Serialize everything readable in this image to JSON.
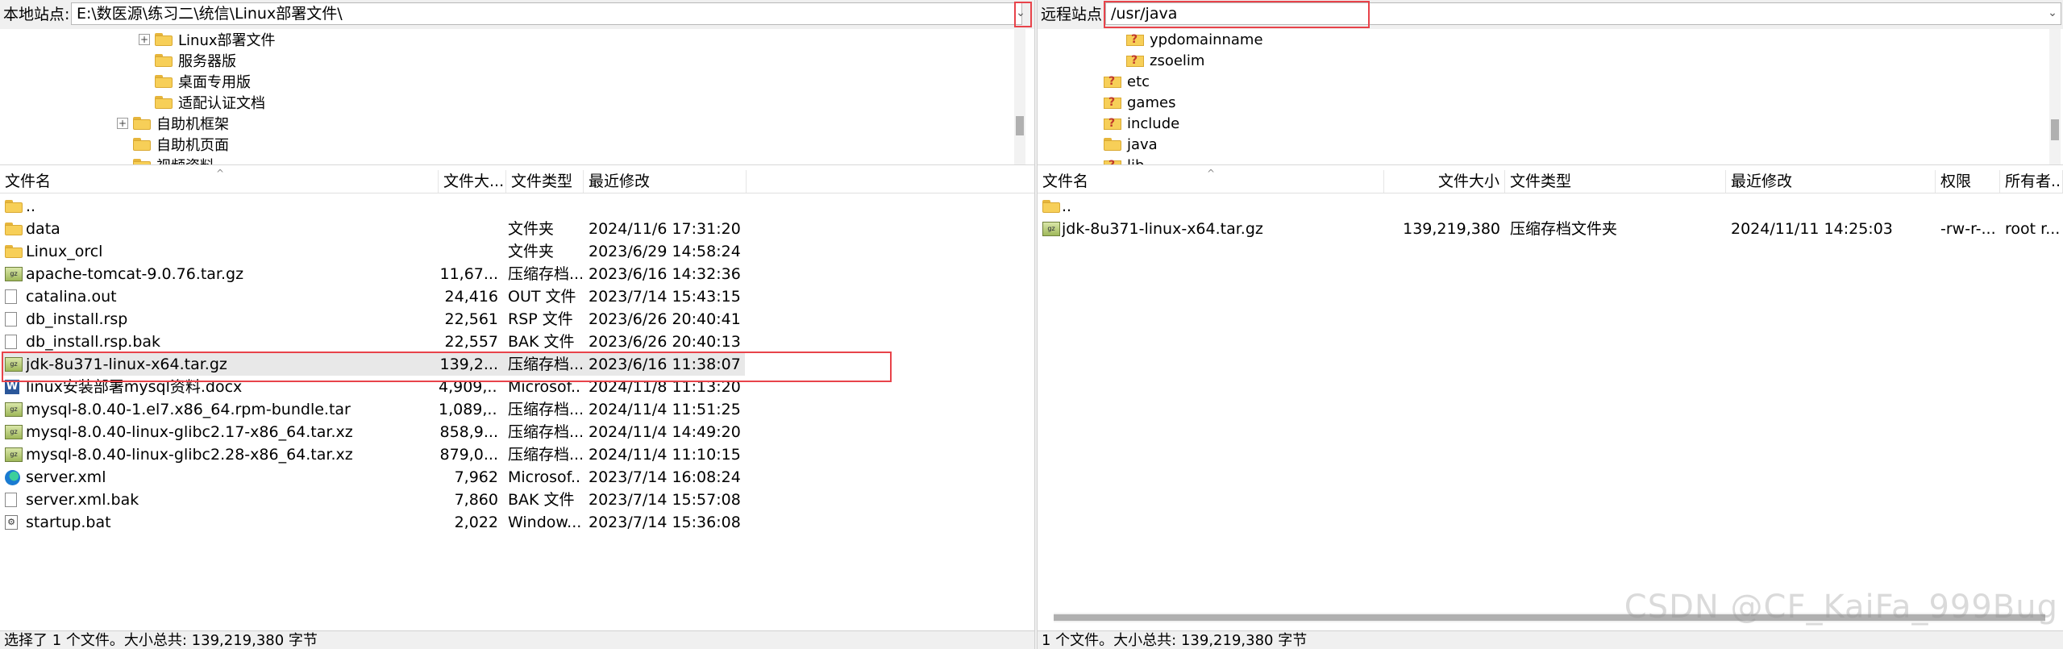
{
  "local": {
    "site_label": "本地站点:",
    "path": "E:\\数医源\\练习二\\统信\\Linux部署文件\\",
    "tree": [
      {
        "label": "Linux部署文件",
        "expander": "+"
      },
      {
        "label": "服务器版"
      },
      {
        "label": "桌面专用版"
      },
      {
        "label": "适配认证文档"
      },
      {
        "label": "自助机框架",
        "expander": "+"
      },
      {
        "label": "自助机页面"
      },
      {
        "label": "视频资料"
      }
    ],
    "columns": {
      "name": "文件名",
      "size": "文件大...",
      "type": "文件类型",
      "modified": "最近修改"
    },
    "rows": [
      {
        "name": "..",
        "size": "",
        "type": "",
        "modified": "",
        "icon": "folder-icon"
      },
      {
        "name": "data",
        "size": "",
        "type": "文件夹",
        "modified": "2024/11/6 17:31:20",
        "icon": "folder-icon"
      },
      {
        "name": "Linux_orcl",
        "size": "",
        "type": "文件夹",
        "modified": "2023/6/29 14:58:24",
        "icon": "folder-icon"
      },
      {
        "name": "apache-tomcat-9.0.76.tar.gz",
        "size": "11,67...",
        "type": "压缩存档...",
        "modified": "2023/6/16 14:32:36",
        "icon": "archive-icon"
      },
      {
        "name": "catalina.out",
        "size": "24,416",
        "type": "OUT 文件",
        "modified": "2023/7/14 15:43:15",
        "icon": "document-icon"
      },
      {
        "name": "db_install.rsp",
        "size": "22,561",
        "type": "RSP 文件",
        "modified": "2023/6/26 20:40:41",
        "icon": "document-icon"
      },
      {
        "name": "db_install.rsp.bak",
        "size": "22,557",
        "type": "BAK 文件",
        "modified": "2023/6/26 20:40:13",
        "icon": "document-icon"
      },
      {
        "name": "jdk-8u371-linux-x64.tar.gz",
        "size": "139,2...",
        "type": "压缩存档...",
        "modified": "2023/6/16 11:38:07",
        "icon": "archive-icon",
        "selected": true
      },
      {
        "name": "linux安装部署mysql资料.docx",
        "size": "4,909,...",
        "type": "Microsof...",
        "modified": "2024/11/8 11:13:20",
        "icon": "word-icon"
      },
      {
        "name": "mysql-8.0.40-1.el7.x86_64.rpm-bundle.tar",
        "size": "1,089,...",
        "type": "压缩存档...",
        "modified": "2024/11/4 11:51:25",
        "icon": "archive-icon"
      },
      {
        "name": "mysql-8.0.40-linux-glibc2.17-x86_64.tar.xz",
        "size": "858,9...",
        "type": "压缩存档...",
        "modified": "2024/11/4 14:49:20",
        "icon": "archive-icon"
      },
      {
        "name": "mysql-8.0.40-linux-glibc2.28-x86_64.tar.xz",
        "size": "879,0...",
        "type": "压缩存档...",
        "modified": "2024/11/4 11:10:15",
        "icon": "archive-icon"
      },
      {
        "name": "server.xml",
        "size": "7,962",
        "type": "Microsof...",
        "modified": "2023/7/14 16:08:24",
        "icon": "edge-icon"
      },
      {
        "name": "server.xml.bak",
        "size": "7,860",
        "type": "BAK 文件",
        "modified": "2023/7/14 15:57:08",
        "icon": "document-icon"
      },
      {
        "name": "startup.bat",
        "size": "2,022",
        "type": "Window...",
        "modified": "2023/7/14 15:36:08",
        "icon": "batch-icon"
      }
    ],
    "status": "选择了 1 个文件。大小总共: 139,219,380 字节"
  },
  "remote": {
    "site_label": "远程站点:",
    "path": "/usr/java",
    "tree": [
      {
        "label": "ypdomainname",
        "icon": "unknown-folder-icon"
      },
      {
        "label": "zsoelim",
        "icon": "unknown-folder-icon"
      },
      {
        "label": "etc",
        "icon": "unknown-folder-icon"
      },
      {
        "label": "games",
        "icon": "unknown-folder-icon"
      },
      {
        "label": "include",
        "icon": "unknown-folder-icon"
      },
      {
        "label": "java",
        "icon": "folder-icon"
      },
      {
        "label": "lib",
        "icon": "unknown-folder-icon"
      }
    ],
    "columns": {
      "name": "文件名",
      "size": "文件大小",
      "type": "文件类型",
      "modified": "最近修改",
      "perms": "权限",
      "owner": "所有者..."
    },
    "rows": [
      {
        "name": "..",
        "size": "",
        "type": "",
        "modified": "",
        "perms": "",
        "owner": "",
        "icon": "folder-icon"
      },
      {
        "name": "jdk-8u371-linux-x64.tar.gz",
        "size": "139,219,380",
        "type": "压缩存档文件夹",
        "modified": "2024/11/11 14:25:03",
        "perms": "-rw-r-...",
        "owner": "root r...",
        "icon": "archive-icon"
      }
    ],
    "status": "1 个文件。大小总共: 139,219,380 字节"
  },
  "watermark": "CSDN @CF_KaiFa_999Bug",
  "colors": {
    "highlight": "#e8434a",
    "selection": "#e8e8e8"
  }
}
